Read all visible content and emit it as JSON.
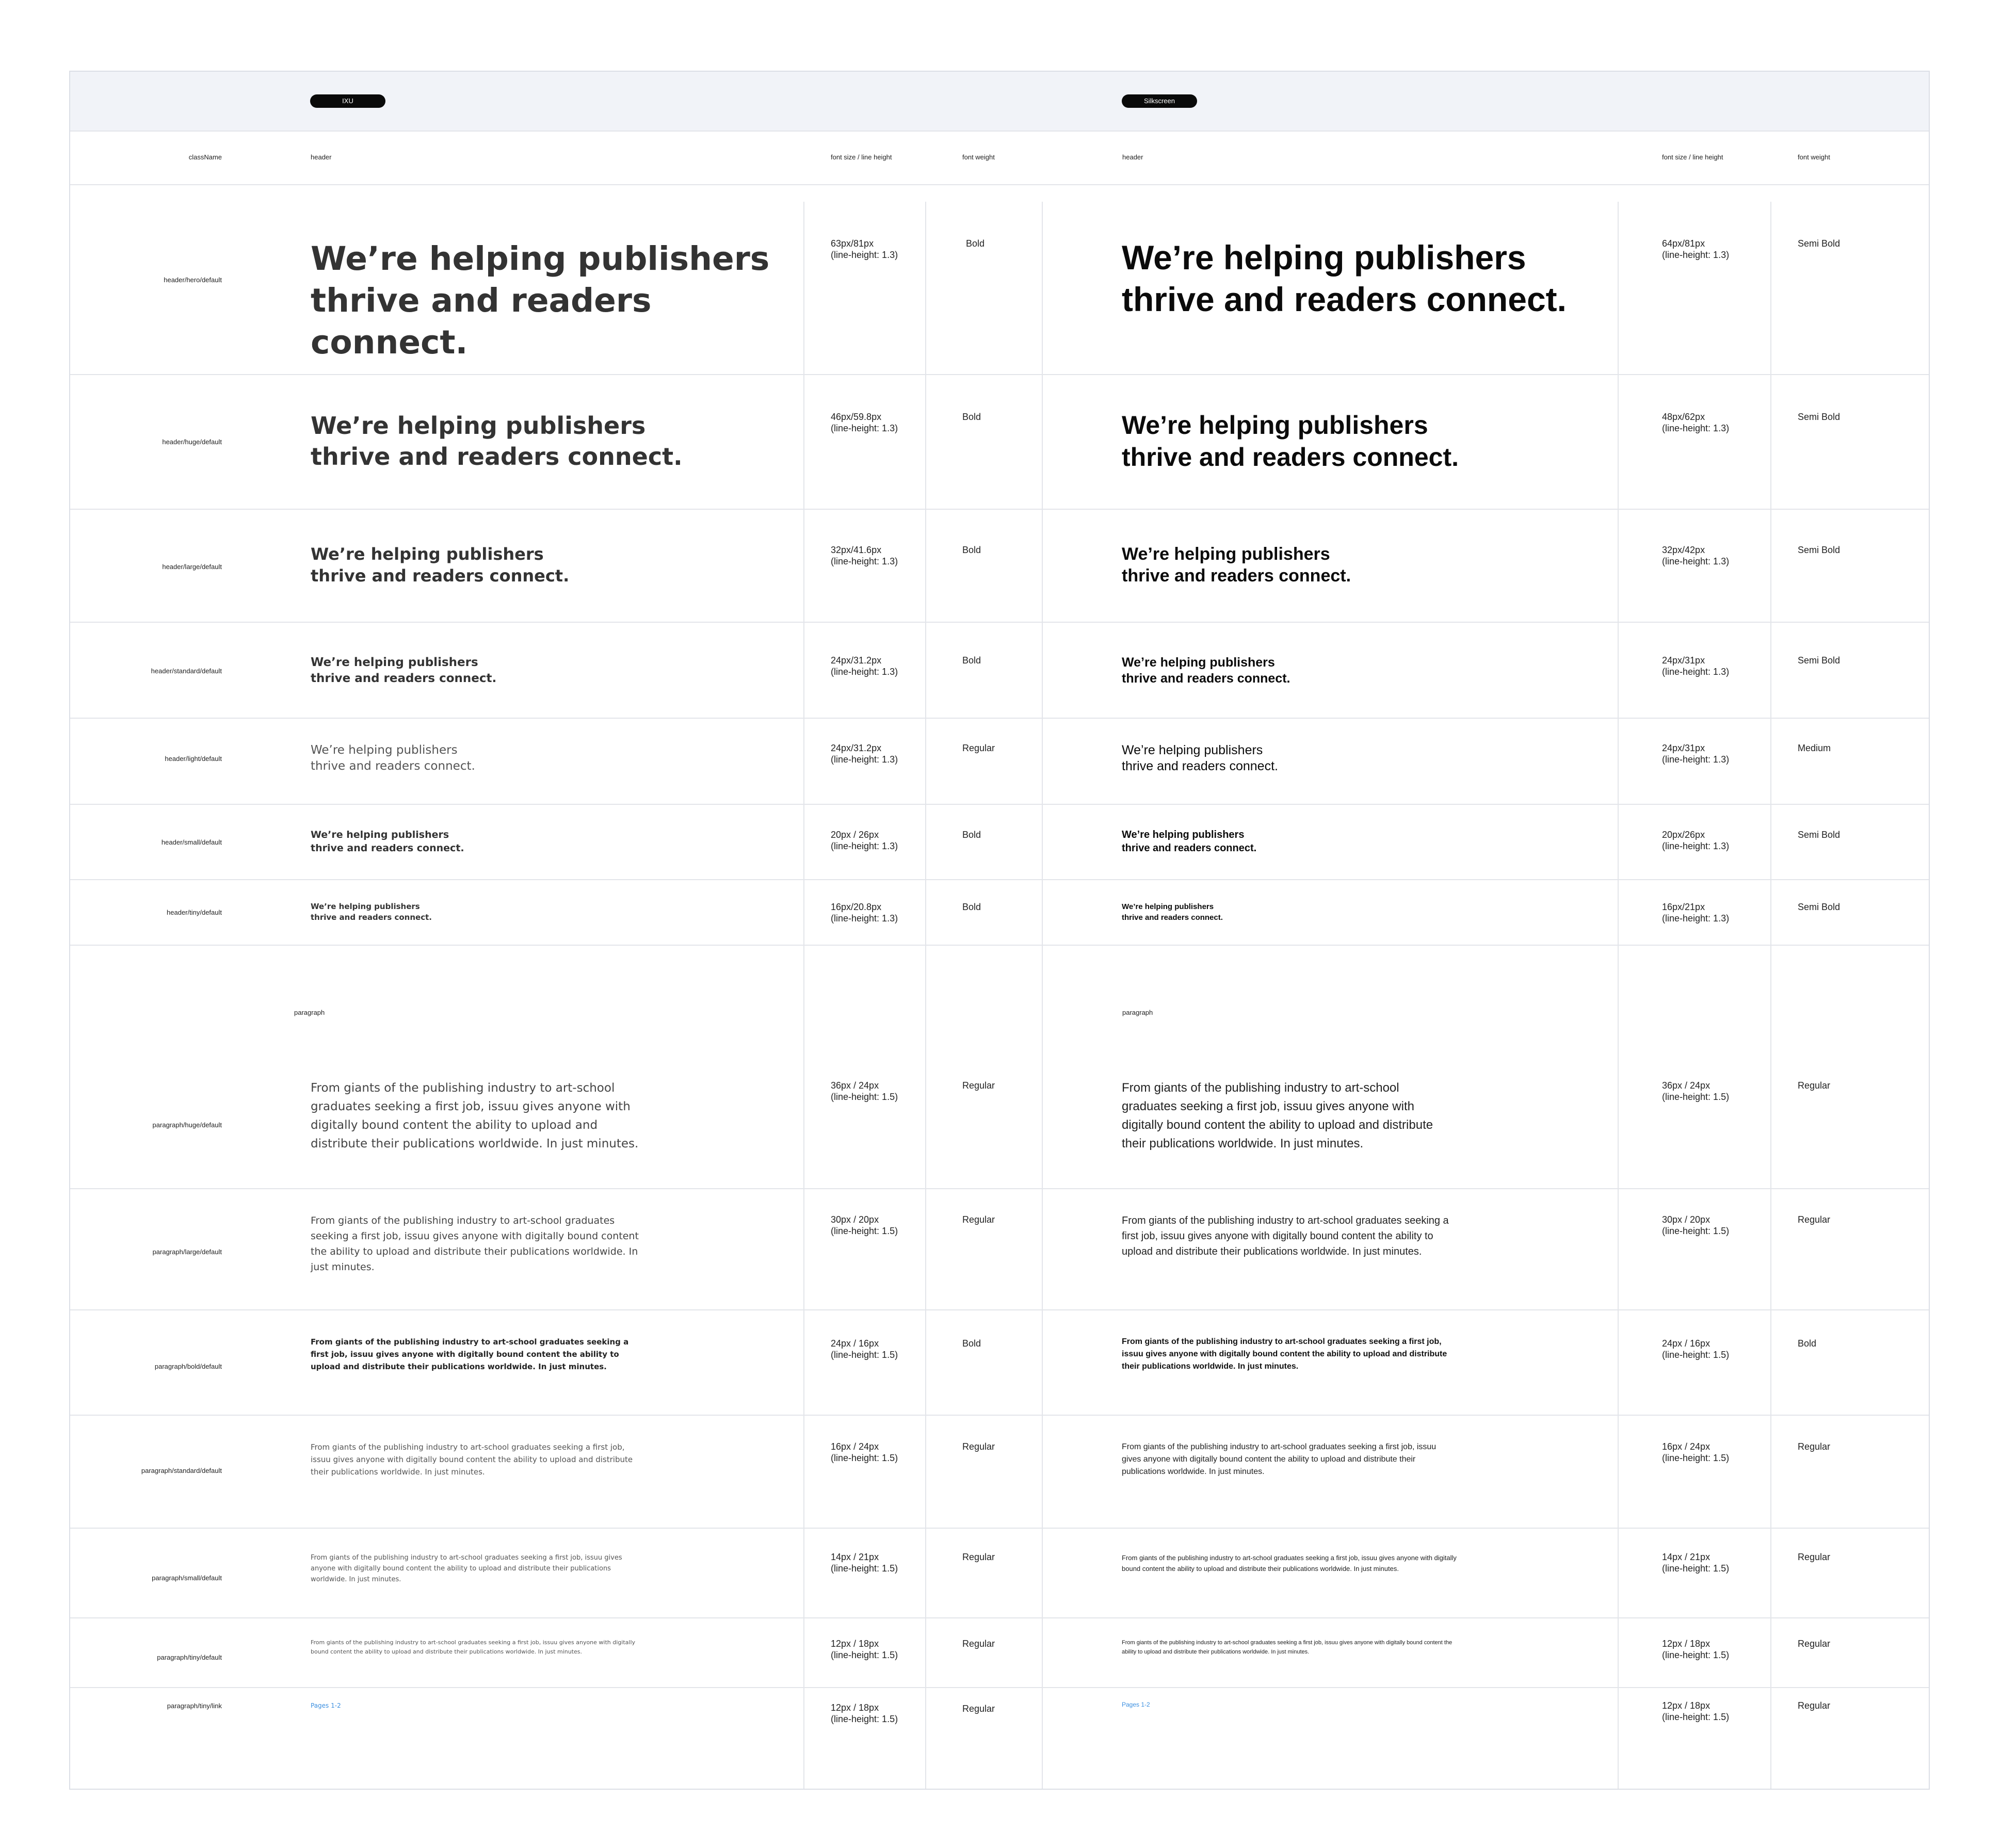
{
  "left_group": {
    "badge": "IXU"
  },
  "right_group": {
    "badge": "Silkscreen"
  },
  "columns": {
    "classname": "className",
    "sample": "header",
    "size": "font size / line height",
    "weight": "font weight"
  },
  "sample_header": "We’re helping publishers thrive and readers connect.",
  "sample_header_l1": "We’re helping publishers",
  "sample_header_l2": "thrive and readers connect.",
  "sample_paragraph": "From giants of the publishing industry to art-school graduates seeking a first job, issuu gives anyone with digitally bound content the ability to upload and distribute their publications worldwide. In just minutes.",
  "sample_link": "Pages 1-2",
  "paragraph_section_label": "paragraph",
  "rows": [
    {
      "cls": "header/hero/default",
      "l_size": "63px/81px\n(line-height: 1.3)",
      "l_weight": "Bold",
      "r_size": "64px/81px\n(line-height: 1.3)",
      "r_weight": "Semi Bold"
    },
    {
      "cls": "header/huge/default",
      "l_size": "46px/59.8px\n(line-height: 1.3)",
      "l_weight": "Bold",
      "r_size": "48px/62px\n(line-height: 1.3)",
      "r_weight": "Semi Bold"
    },
    {
      "cls": "header/large/default",
      "l_size": "32px/41.6px\n(line-height: 1.3)",
      "l_weight": "Bold",
      "r_size": "32px/42px\n(line-height: 1.3)",
      "r_weight": "Semi Bold"
    },
    {
      "cls": "header/standard/default",
      "l_size": "24px/31.2px\n(line-height: 1.3)",
      "l_weight": "Bold",
      "r_size": "24px/31px\n(line-height: 1.3)",
      "r_weight": "Semi Bold"
    },
    {
      "cls": "header/light/default",
      "l_size": "24px/31.2px\n(line-height: 1.3)",
      "l_weight": "Regular",
      "r_size": "24px/31px\n(line-height: 1.3)",
      "r_weight": "Medium"
    },
    {
      "cls": "header/small/default",
      "l_size": "20px / 26px\n(line-height: 1.3)",
      "l_weight": "Bold",
      "r_size": "20px/26px\n(line-height: 1.3)",
      "r_weight": "Semi Bold"
    },
    {
      "cls": "header/tiny/default",
      "l_size": "16px/20.8px\n(line-height: 1.3)",
      "l_weight": "Bold",
      "r_size": "16px/21px\n(line-height: 1.3)",
      "r_weight": "Semi Bold"
    },
    {
      "cls": "paragraph/huge/default",
      "l_size": "36px / 24px\n(line-height: 1.5)",
      "l_weight": "Regular",
      "r_size": "36px / 24px\n(line-height: 1.5)",
      "r_weight": "Regular"
    },
    {
      "cls": "paragraph/large/default",
      "l_size": "30px / 20px\n(line-height: 1.5)",
      "l_weight": "Regular",
      "r_size": "30px / 20px\n(line-height: 1.5)",
      "r_weight": "Regular"
    },
    {
      "cls": "paragraph/bold/default",
      "l_size": "24px / 16px\n(line-height: 1.5)",
      "l_weight": "Bold",
      "r_size": "24px / 16px\n(line-height: 1.5)",
      "r_weight": "Bold"
    },
    {
      "cls": "paragraph/standard/default",
      "l_size": "16px / 24px\n(line-height: 1.5)",
      "l_weight": "Regular",
      "r_size": "16px / 24px\n(line-height: 1.5)",
      "r_weight": "Regular"
    },
    {
      "cls": "paragraph/small/default",
      "l_size": "14px / 21px\n(line-height: 1.5)",
      "l_weight": "Regular",
      "r_size": "14px / 21px\n(line-height: 1.5)",
      "r_weight": "Regular"
    },
    {
      "cls": "paragraph/tiny/default",
      "l_size": "12px / 18px\n(line-height: 1.5)",
      "l_weight": "Regular",
      "r_size": "12px / 18px\n(line-height: 1.5)",
      "r_weight": "Regular"
    },
    {
      "cls": "paragraph/tiny/link",
      "l_size": "12px / 18px\n(line-height: 1.5)",
      "l_weight": "Regular",
      "r_size": "12px / 18px\n(line-height: 1.5)",
      "r_weight": "Regular"
    }
  ]
}
